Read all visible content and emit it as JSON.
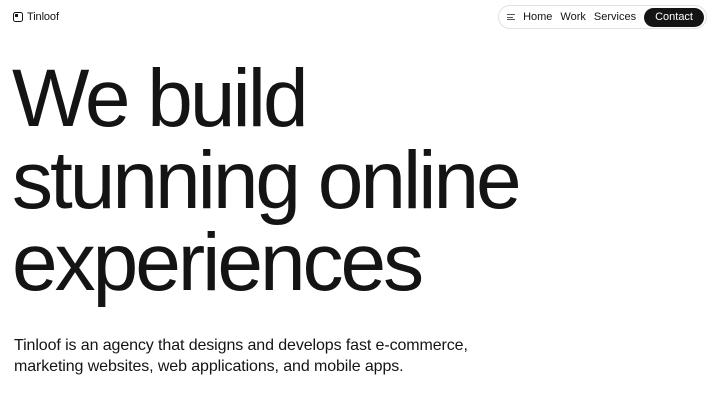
{
  "brand": {
    "name": "Tinloof"
  },
  "nav": {
    "menu_icon": "menu-lines-icon",
    "links": [
      {
        "label": "Home"
      },
      {
        "label": "Work"
      },
      {
        "label": "Services"
      }
    ],
    "cta_label": "Contact"
  },
  "hero": {
    "lines": [
      "We build",
      "stunning online",
      "experiences"
    ]
  },
  "subtitle": {
    "lines": [
      "Tinloof is an agency that designs and develops fast e-commerce,",
      "marketing websites, web applications, and mobile apps."
    ]
  },
  "colors": {
    "text": "#141414",
    "background": "#ffffff",
    "cta_background": "#141414",
    "cta_text": "#ffffff",
    "nav_border": "#e2e2e2"
  }
}
